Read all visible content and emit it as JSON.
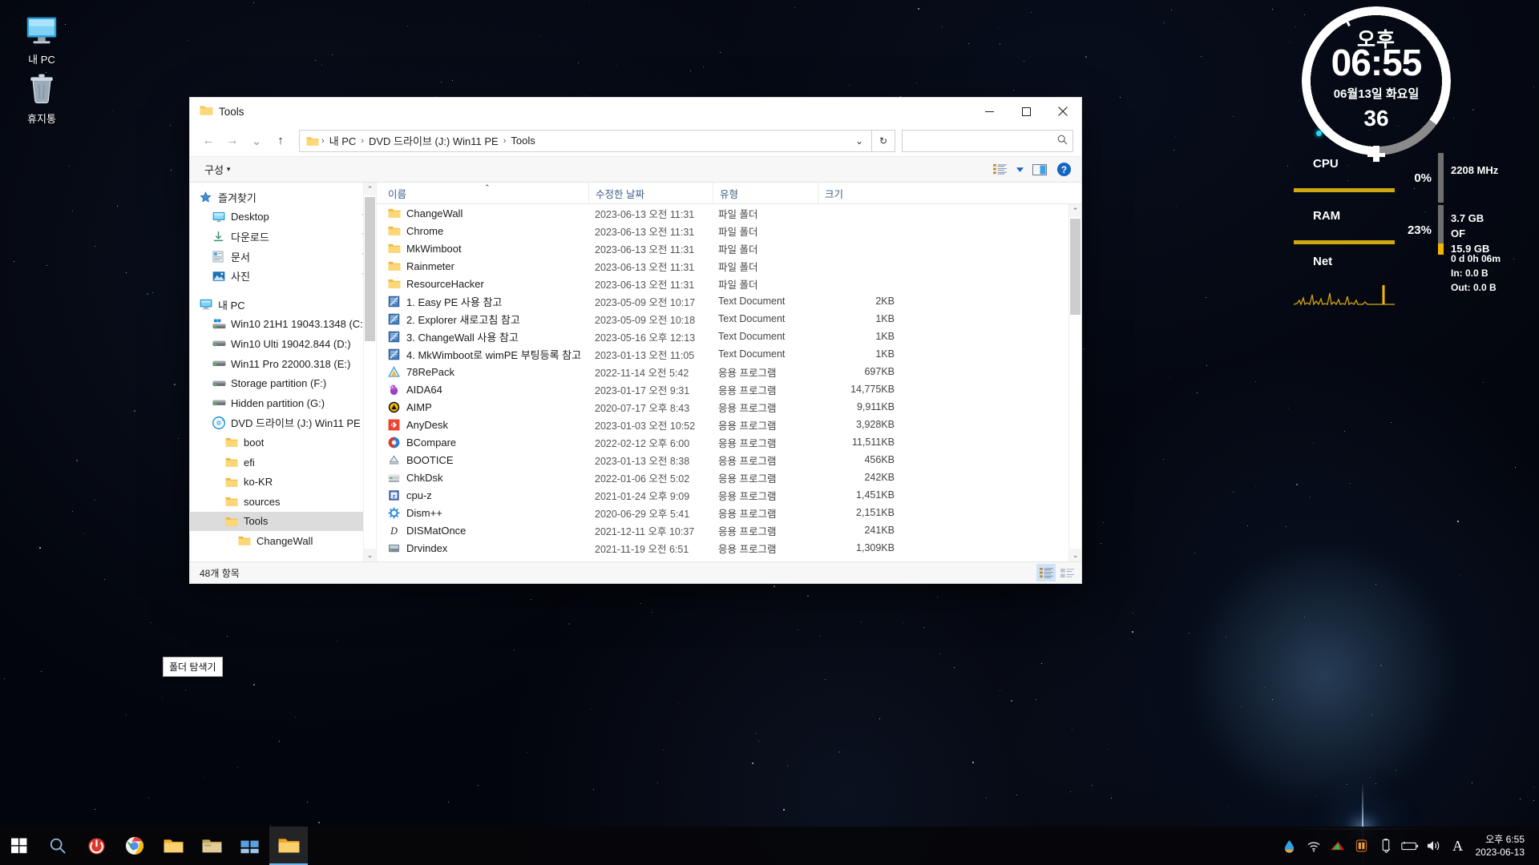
{
  "desktop": {
    "icons": [
      {
        "name": "내 PC",
        "icon": "computer-icon"
      },
      {
        "name": "휴지통",
        "icon": "recycle-bin-icon"
      }
    ]
  },
  "window": {
    "title": "Tools",
    "title_icon": "folder-icon",
    "minimize_label": "─",
    "maximize_label": "☐",
    "close_label": "✕",
    "nav": {
      "back": "←",
      "forward": "→",
      "recent": "⌄",
      "up": "↑"
    },
    "address": {
      "icon": "folder-icon",
      "crumbs": [
        "내 PC",
        "DVD 드라이브 (J:) Win11 PE",
        "Tools"
      ],
      "separator": "›",
      "dropdown": "⌄",
      "refresh": "↻"
    },
    "search": {
      "value": "",
      "placeholder": "",
      "icon": "search-icon"
    },
    "toolbar": {
      "organize_label": "구성",
      "organize_caret": "▾",
      "view_icon": "view-list-icon",
      "view_caret": "▾",
      "pane_icon": "preview-pane-icon",
      "help_icon": "help-icon"
    }
  },
  "navpane": {
    "items": [
      {
        "label": "즐겨찾기",
        "icon": "favorites-star-icon",
        "indent": 0,
        "pinned": false,
        "selected": false
      },
      {
        "label": "Desktop",
        "icon": "desktop-icon",
        "indent": 1,
        "pinned": true,
        "selected": false
      },
      {
        "label": "다운로드",
        "icon": "downloads-icon",
        "indent": 1,
        "pinned": true,
        "selected": false
      },
      {
        "label": "문서",
        "icon": "documents-icon",
        "indent": 1,
        "pinned": true,
        "selected": false
      },
      {
        "label": "사진",
        "icon": "pictures-icon",
        "indent": 1,
        "pinned": true,
        "selected": false
      },
      {
        "label": "",
        "icon": "spacer",
        "indent": 0,
        "pinned": false,
        "selected": false
      },
      {
        "label": "내 PC",
        "icon": "computer-icon",
        "indent": 0,
        "pinned": false,
        "selected": false
      },
      {
        "label": "Win10 21H1 19043.1348 (C:)",
        "icon": "windows-drive-icon",
        "indent": 1,
        "pinned": false,
        "selected": false
      },
      {
        "label": "Win10 Ulti 19042.844 (D:)",
        "icon": "drive-icon",
        "indent": 1,
        "pinned": false,
        "selected": false
      },
      {
        "label": "Win11 Pro 22000.318 (E:)",
        "icon": "drive-icon",
        "indent": 1,
        "pinned": false,
        "selected": false
      },
      {
        "label": "Storage partition (F:)",
        "icon": "drive-icon",
        "indent": 1,
        "pinned": false,
        "selected": false
      },
      {
        "label": "Hidden partition (G:)",
        "icon": "drive-icon",
        "indent": 1,
        "pinned": false,
        "selected": false
      },
      {
        "label": "DVD 드라이브 (J:) Win11 PE",
        "icon": "dvd-drive-icon",
        "indent": 1,
        "pinned": false,
        "selected": false
      },
      {
        "label": "boot",
        "icon": "folder-icon",
        "indent": 2,
        "pinned": false,
        "selected": false
      },
      {
        "label": "efi",
        "icon": "folder-icon",
        "indent": 2,
        "pinned": false,
        "selected": false
      },
      {
        "label": "ko-KR",
        "icon": "folder-icon",
        "indent": 2,
        "pinned": false,
        "selected": false
      },
      {
        "label": "sources",
        "icon": "folder-icon",
        "indent": 2,
        "pinned": false,
        "selected": false
      },
      {
        "label": "Tools",
        "icon": "folder-icon",
        "indent": 2,
        "pinned": false,
        "selected": true
      },
      {
        "label": "ChangeWall",
        "icon": "folder-icon",
        "indent": 3,
        "pinned": false,
        "selected": false
      }
    ],
    "scroll_up": "⌃",
    "scroll_down": "⌄"
  },
  "filelist": {
    "columns": [
      "이름",
      "수정한 날짜",
      "유형",
      "크기"
    ],
    "sort_indicator": "⌃",
    "rows": [
      {
        "name": "ChangeWall",
        "icon": "folder-icon",
        "date": "2023-06-13 오전 11:31",
        "type": "파일 폴더",
        "size": ""
      },
      {
        "name": "Chrome",
        "icon": "folder-icon",
        "date": "2023-06-13 오전 11:31",
        "type": "파일 폴더",
        "size": ""
      },
      {
        "name": "MkWimboot",
        "icon": "folder-icon",
        "date": "2023-06-13 오전 11:31",
        "type": "파일 폴더",
        "size": ""
      },
      {
        "name": "Rainmeter",
        "icon": "folder-icon",
        "date": "2023-06-13 오전 11:31",
        "type": "파일 폴더",
        "size": ""
      },
      {
        "name": "ResourceHacker",
        "icon": "folder-icon",
        "date": "2023-06-13 오전 11:31",
        "type": "파일 폴더",
        "size": ""
      },
      {
        "name": "1. Easy PE 사용 참고",
        "icon": "text-document-icon",
        "date": "2023-05-09 오전 10:17",
        "type": "Text Document",
        "size": "2KB"
      },
      {
        "name": "2. Explorer 새로고침 참고",
        "icon": "text-document-icon",
        "date": "2023-05-09 오전 10:18",
        "type": "Text Document",
        "size": "1KB"
      },
      {
        "name": "3. ChangeWall 사용 참고",
        "icon": "text-document-icon",
        "date": "2023-05-16 오후 12:13",
        "type": "Text Document",
        "size": "1KB"
      },
      {
        "name": "4. MkWimboot로 wimPE 부팅등록 참고",
        "icon": "text-document-icon",
        "date": "2023-01-13 오전 11:05",
        "type": "Text Document",
        "size": "1KB"
      },
      {
        "name": "78RePack",
        "icon": "app-78repack-icon",
        "date": "2022-11-14 오전 5:42",
        "type": "응용 프로그램",
        "size": "697KB"
      },
      {
        "name": "AIDA64",
        "icon": "app-aida64-icon",
        "date": "2023-01-17 오전 9:31",
        "type": "응용 프로그램",
        "size": "14,775KB"
      },
      {
        "name": "AIMP",
        "icon": "app-aimp-icon",
        "date": "2020-07-17 오후 8:43",
        "type": "응용 프로그램",
        "size": "9,911KB"
      },
      {
        "name": "AnyDesk",
        "icon": "app-anydesk-icon",
        "date": "2023-01-03 오전 10:52",
        "type": "응용 프로그램",
        "size": "3,928KB"
      },
      {
        "name": "BCompare",
        "icon": "app-bcompare-icon",
        "date": "2022-02-12 오후 6:00",
        "type": "응용 프로그램",
        "size": "11,511KB"
      },
      {
        "name": "BOOTICE",
        "icon": "app-bootice-icon",
        "date": "2023-01-13 오전 8:38",
        "type": "응용 프로그램",
        "size": "456KB"
      },
      {
        "name": "ChkDsk",
        "icon": "app-chkdsk-icon",
        "date": "2022-01-06 오전 5:02",
        "type": "응용 프로그램",
        "size": "242KB"
      },
      {
        "name": "cpu-z",
        "icon": "app-cpuz-icon",
        "date": "2021-01-24 오후 9:09",
        "type": "응용 프로그램",
        "size": "1,451KB"
      },
      {
        "name": "Dism++",
        "icon": "app-dism-icon",
        "date": "2020-06-29 오후 5:41",
        "type": "응용 프로그램",
        "size": "2,151KB"
      },
      {
        "name": "DISMatOnce",
        "icon": "app-dismatonce-icon",
        "date": "2021-12-11 오후 10:37",
        "type": "응용 프로그램",
        "size": "241KB"
      },
      {
        "name": "Drvindex",
        "icon": "app-drvindex-icon",
        "date": "2021-11-19 오전 6:51",
        "type": "응용 프로그램",
        "size": "1,309KB"
      }
    ],
    "scroll_up": "⌃",
    "scroll_down": "⌄"
  },
  "statusbar": {
    "item_count": "48개 항목",
    "view_details_icon": "details-view-icon",
    "view_tiles_icon": "tiles-view-icon"
  },
  "widgets": {
    "clock": {
      "ampm": "오후",
      "time": "06:55",
      "date": "06월13일 화요일",
      "seconds": "36"
    },
    "cpu": {
      "label": "CPU",
      "percent": "0%",
      "percent_value": 0,
      "frequency": "2208 MHz"
    },
    "ram": {
      "label": "RAM",
      "percent": "23%",
      "percent_value": 23,
      "used": "3.7 GB",
      "of": "OF",
      "total": "15.9 GB"
    },
    "net": {
      "label": "Net",
      "uptime": "0 d 0h 06m",
      "in": "In: 0.0 B",
      "out": "Out: 0.0 B"
    }
  },
  "taskbar": {
    "start_icon": "windows-start-icon",
    "buttons": [
      {
        "name": "search-taskbar",
        "icon": "search-icon"
      },
      {
        "name": "power-button",
        "icon": "power-icon"
      },
      {
        "name": "chrome",
        "icon": "chrome-icon"
      },
      {
        "name": "file-explorer-1",
        "icon": "folder-icon"
      },
      {
        "name": "folder-explorer-hover",
        "icon": "folder-explorer-icon"
      },
      {
        "name": "task-view",
        "icon": "task-view-icon"
      },
      {
        "name": "file-explorer-active",
        "icon": "folder-icon"
      }
    ],
    "tooltip": "폴더 탐색기",
    "tray": [
      {
        "name": "water-drop-icon"
      },
      {
        "name": "wifi-icon"
      },
      {
        "name": "nvidia-icon"
      },
      {
        "name": "usb-device-icon"
      },
      {
        "name": "usb-drive-icon"
      },
      {
        "name": "battery-icon"
      },
      {
        "name": "volume-icon"
      },
      {
        "name": "ime-icon",
        "glyph": "A"
      }
    ],
    "clock_time": "오후 6:55",
    "clock_date": "2023-06-13"
  },
  "colors": {
    "accent": "#f4b400",
    "selection": "#cfe3f7",
    "folder": "#f6c552",
    "link": "#3b5f8a"
  }
}
